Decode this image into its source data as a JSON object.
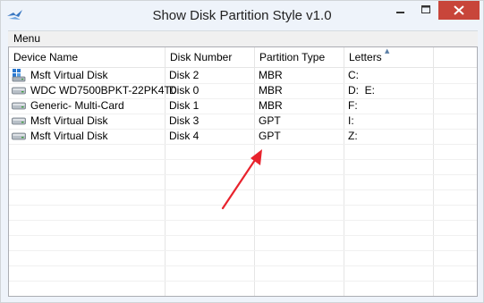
{
  "window": {
    "title": "Show Disk Partition Style v1.0"
  },
  "menu": {
    "label": "Menu"
  },
  "columns": [
    "Device Name",
    "Disk Number",
    "Partition Type",
    "Letters"
  ],
  "rows": [
    {
      "device": "Msft Virtual Disk",
      "disk": "Disk 2",
      "type": "MBR",
      "letters": "C:",
      "icon": "virtual-disk-icon"
    },
    {
      "device": "WDC WD7500BPKT-22PK4T0",
      "disk": "Disk 0",
      "type": "MBR",
      "letters": "D:  E:",
      "icon": "hard-disk-icon"
    },
    {
      "device": "Generic- Multi-Card",
      "disk": "Disk 1",
      "type": "MBR",
      "letters": "F:",
      "icon": "hard-disk-icon"
    },
    {
      "device": "Msft Virtual Disk",
      "disk": "Disk 3",
      "type": "GPT",
      "letters": "I:",
      "icon": "hard-disk-icon"
    },
    {
      "device": "Msft Virtual Disk",
      "disk": "Disk 4",
      "type": "GPT",
      "letters": "Z:",
      "icon": "hard-disk-icon"
    }
  ],
  "colors": {
    "close_button": "#c8453a",
    "annotation_arrow": "#e8232d"
  }
}
